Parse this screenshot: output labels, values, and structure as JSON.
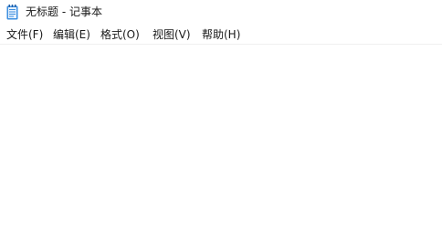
{
  "window": {
    "title": "无标题 - 记事本",
    "app_icon": "notepad-icon"
  },
  "menu": {
    "file": "文件(F)",
    "edit": "编辑(E)",
    "format": "格式(O)",
    "view": "视图(V)",
    "help": "帮助(H)"
  },
  "editor": {
    "content": ""
  },
  "colors": {
    "background": "#ffffff",
    "icon_blue": "#3d8fe0",
    "separator": "#f0f0f0"
  }
}
